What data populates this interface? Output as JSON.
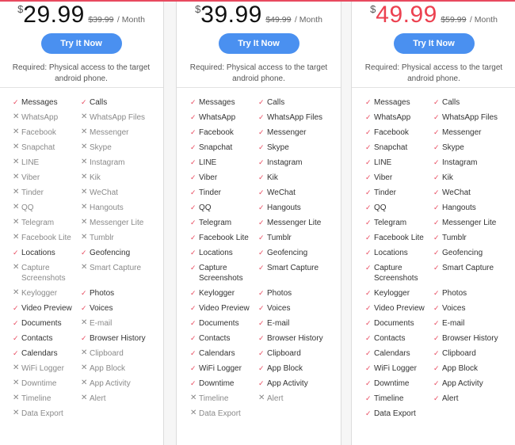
{
  "accent_color": "#e84a5f",
  "button_color": "#4a90f0",
  "plans": [
    {
      "currency": "$",
      "price": "29.99",
      "old_price": "$39.99",
      "period": "/ Month",
      "price_color": "#111111",
      "button_label": "Try It Now",
      "requirement": "Required: Physical access to the target android phone.",
      "features": [
        [
          {
            "label": "Messages",
            "included": true
          },
          {
            "label": "Calls",
            "included": true
          }
        ],
        [
          {
            "label": "WhatsApp",
            "included": false
          },
          {
            "label": "WhatsApp Files",
            "included": false
          }
        ],
        [
          {
            "label": "Facebook",
            "included": false
          },
          {
            "label": "Messenger",
            "included": false
          }
        ],
        [
          {
            "label": "Snapchat",
            "included": false
          },
          {
            "label": "Skype",
            "included": false
          }
        ],
        [
          {
            "label": "LINE",
            "included": false
          },
          {
            "label": "Instagram",
            "included": false
          }
        ],
        [
          {
            "label": "Viber",
            "included": false
          },
          {
            "label": "Kik",
            "included": false
          }
        ],
        [
          {
            "label": "Tinder",
            "included": false
          },
          {
            "label": "WeChat",
            "included": false
          }
        ],
        [
          {
            "label": "QQ",
            "included": false
          },
          {
            "label": "Hangouts",
            "included": false
          }
        ],
        [
          {
            "label": "Telegram",
            "included": false
          },
          {
            "label": "Messenger Lite",
            "included": false
          }
        ],
        [
          {
            "label": "Facebook Lite",
            "included": false
          },
          {
            "label": "Tumblr",
            "included": false
          }
        ],
        [
          {
            "label": "Locations",
            "included": true
          },
          {
            "label": "Geofencing",
            "included": true
          }
        ],
        [
          {
            "label": "Capture Screenshots",
            "included": false
          },
          {
            "label": "Smart Capture",
            "included": false
          }
        ],
        [
          {
            "label": "Keylogger",
            "included": false
          },
          {
            "label": "Photos",
            "included": true
          }
        ],
        [
          {
            "label": "Video Preview",
            "included": true
          },
          {
            "label": "Voices",
            "included": true
          }
        ],
        [
          {
            "label": "Documents",
            "included": true
          },
          {
            "label": "E-mail",
            "included": false
          }
        ],
        [
          {
            "label": "Contacts",
            "included": true
          },
          {
            "label": "Browser History",
            "included": true
          }
        ],
        [
          {
            "label": "Calendars",
            "included": true
          },
          {
            "label": "Clipboard",
            "included": false
          }
        ],
        [
          {
            "label": "WiFi Logger",
            "included": false
          },
          {
            "label": "App Block",
            "included": false
          }
        ],
        [
          {
            "label": "Downtime",
            "included": false
          },
          {
            "label": "App Activity",
            "included": false
          }
        ],
        [
          {
            "label": "Timeline",
            "included": false
          },
          {
            "label": "Alert",
            "included": false
          }
        ],
        [
          {
            "label": "Data Export",
            "included": false
          },
          null
        ]
      ]
    },
    {
      "currency": "$",
      "price": "39.99",
      "old_price": "$49.99",
      "period": "/ Month",
      "price_color": "#111111",
      "button_label": "Try It Now",
      "requirement": "Required: Physical access to the target android phone.",
      "features": [
        [
          {
            "label": "Messages",
            "included": true
          },
          {
            "label": "Calls",
            "included": true
          }
        ],
        [
          {
            "label": "WhatsApp",
            "included": true
          },
          {
            "label": "WhatsApp Files",
            "included": true
          }
        ],
        [
          {
            "label": "Facebook",
            "included": true
          },
          {
            "label": "Messenger",
            "included": true
          }
        ],
        [
          {
            "label": "Snapchat",
            "included": true
          },
          {
            "label": "Skype",
            "included": true
          }
        ],
        [
          {
            "label": "LINE",
            "included": true
          },
          {
            "label": "Instagram",
            "included": true
          }
        ],
        [
          {
            "label": "Viber",
            "included": true
          },
          {
            "label": "Kik",
            "included": true
          }
        ],
        [
          {
            "label": "Tinder",
            "included": true
          },
          {
            "label": "WeChat",
            "included": true
          }
        ],
        [
          {
            "label": "QQ",
            "included": true
          },
          {
            "label": "Hangouts",
            "included": true
          }
        ],
        [
          {
            "label": "Telegram",
            "included": true
          },
          {
            "label": "Messenger Lite",
            "included": true
          }
        ],
        [
          {
            "label": "Facebook Lite",
            "included": true
          },
          {
            "label": "Tumblr",
            "included": true
          }
        ],
        [
          {
            "label": "Locations",
            "included": true
          },
          {
            "label": "Geofencing",
            "included": true
          }
        ],
        [
          {
            "label": "Capture Screenshots",
            "included": true
          },
          {
            "label": "Smart Capture",
            "included": true
          }
        ],
        [
          {
            "label": "Keylogger",
            "included": true
          },
          {
            "label": "Photos",
            "included": true
          }
        ],
        [
          {
            "label": "Video Preview",
            "included": true
          },
          {
            "label": "Voices",
            "included": true
          }
        ],
        [
          {
            "label": "Documents",
            "included": true
          },
          {
            "label": "E-mail",
            "included": true
          }
        ],
        [
          {
            "label": "Contacts",
            "included": true
          },
          {
            "label": "Browser History",
            "included": true
          }
        ],
        [
          {
            "label": "Calendars",
            "included": true
          },
          {
            "label": "Clipboard",
            "included": true
          }
        ],
        [
          {
            "label": "WiFi Logger",
            "included": true
          },
          {
            "label": "App Block",
            "included": true
          }
        ],
        [
          {
            "label": "Downtime",
            "included": true
          },
          {
            "label": "App Activity",
            "included": true
          }
        ],
        [
          {
            "label": "Timeline",
            "included": false
          },
          {
            "label": "Alert",
            "included": false
          }
        ],
        [
          {
            "label": "Data Export",
            "included": false
          },
          null
        ]
      ]
    },
    {
      "currency": "$",
      "price": "49.99",
      "old_price": "$59.99",
      "period": "/ Month",
      "price_color": "#ec4150",
      "button_label": "Try It Now",
      "requirement": "Required: Physical access to the target android phone.",
      "features": [
        [
          {
            "label": "Messages",
            "included": true
          },
          {
            "label": "Calls",
            "included": true
          }
        ],
        [
          {
            "label": "WhatsApp",
            "included": true
          },
          {
            "label": "WhatsApp Files",
            "included": true
          }
        ],
        [
          {
            "label": "Facebook",
            "included": true
          },
          {
            "label": "Messenger",
            "included": true
          }
        ],
        [
          {
            "label": "Snapchat",
            "included": true
          },
          {
            "label": "Skype",
            "included": true
          }
        ],
        [
          {
            "label": "LINE",
            "included": true
          },
          {
            "label": "Instagram",
            "included": true
          }
        ],
        [
          {
            "label": "Viber",
            "included": true
          },
          {
            "label": "Kik",
            "included": true
          }
        ],
        [
          {
            "label": "Tinder",
            "included": true
          },
          {
            "label": "WeChat",
            "included": true
          }
        ],
        [
          {
            "label": "QQ",
            "included": true
          },
          {
            "label": "Hangouts",
            "included": true
          }
        ],
        [
          {
            "label": "Telegram",
            "included": true
          },
          {
            "label": "Messenger Lite",
            "included": true
          }
        ],
        [
          {
            "label": "Facebook Lite",
            "included": true
          },
          {
            "label": "Tumblr",
            "included": true
          }
        ],
        [
          {
            "label": "Locations",
            "included": true
          },
          {
            "label": "Geofencing",
            "included": true
          }
        ],
        [
          {
            "label": "Capture Screenshots",
            "included": true
          },
          {
            "label": "Smart Capture",
            "included": true
          }
        ],
        [
          {
            "label": "Keylogger",
            "included": true
          },
          {
            "label": "Photos",
            "included": true
          }
        ],
        [
          {
            "label": "Video Preview",
            "included": true
          },
          {
            "label": "Voices",
            "included": true
          }
        ],
        [
          {
            "label": "Documents",
            "included": true
          },
          {
            "label": "E-mail",
            "included": true
          }
        ],
        [
          {
            "label": "Contacts",
            "included": true
          },
          {
            "label": "Browser History",
            "included": true
          }
        ],
        [
          {
            "label": "Calendars",
            "included": true
          },
          {
            "label": "Clipboard",
            "included": true
          }
        ],
        [
          {
            "label": "WiFi Logger",
            "included": true
          },
          {
            "label": "App Block",
            "included": true
          }
        ],
        [
          {
            "label": "Downtime",
            "included": true
          },
          {
            "label": "App Activity",
            "included": true
          }
        ],
        [
          {
            "label": "Timeline",
            "included": true
          },
          {
            "label": "Alert",
            "included": true
          }
        ],
        [
          {
            "label": "Data Export",
            "included": true
          },
          null
        ]
      ]
    }
  ],
  "icons": {
    "included": "check-icon",
    "excluded": "cross-icon",
    "included_glyph": "✓",
    "excluded_glyph": "✕"
  }
}
